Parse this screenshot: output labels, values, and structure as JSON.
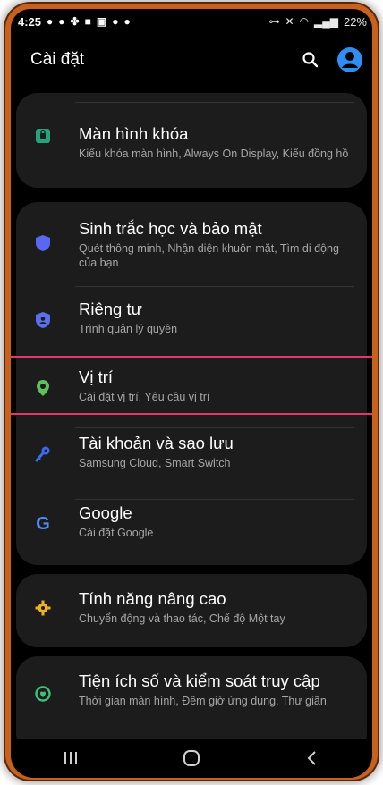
{
  "status_bar": {
    "time": "4:25",
    "battery": "22%"
  },
  "app_bar": {
    "title": "Cài đặt"
  },
  "colors": {
    "accent": "#2f8ef4",
    "highlight": "#e8336b",
    "lock_icon": "#26a37a",
    "shield_icon": "#5868f0",
    "privacy_icon": "#5a6ff0",
    "location_icon": "#5ec05a",
    "key_icon": "#3a6bf0",
    "google_icon": "#4f8cf5",
    "advanced_icon": "#f0b020",
    "wellbeing_icon": "#3fbf7a"
  },
  "settings": [
    {
      "icon": "lock-icon",
      "title": "Màn hình khóa",
      "subtitle": "Kiểu khóa màn hình, Always On Display, Kiểu đồng hồ"
    },
    {
      "icon": "shield-icon",
      "title": "Sinh trắc học và bảo mật",
      "subtitle": "Quét thông minh, Nhận diện khuôn mặt, Tìm di động của bạn"
    },
    {
      "icon": "privacy-shield-icon",
      "title": "Riêng tư",
      "subtitle": "Trình quản lý quyền"
    },
    {
      "icon": "location-pin-icon",
      "title": "Vị trí",
      "subtitle": "Cài đặt vị trí, Yêu cầu vị trí"
    },
    {
      "icon": "key-icon",
      "title": "Tài khoản và sao lưu",
      "subtitle": "Samsung Cloud, Smart Switch"
    },
    {
      "icon": "google-icon",
      "title": "Google",
      "subtitle": "Cài đặt Google"
    },
    {
      "icon": "puzzle-gear-icon",
      "title": "Tính năng nâng cao",
      "subtitle": "Chuyển động và thao tác, Chế độ Một tay"
    },
    {
      "icon": "wellbeing-icon",
      "title": "Tiện ích số và kiểm soát truy cập",
      "subtitle": "Thời gian màn hình, Đếm giờ ứng dụng, Thư giãn"
    }
  ]
}
